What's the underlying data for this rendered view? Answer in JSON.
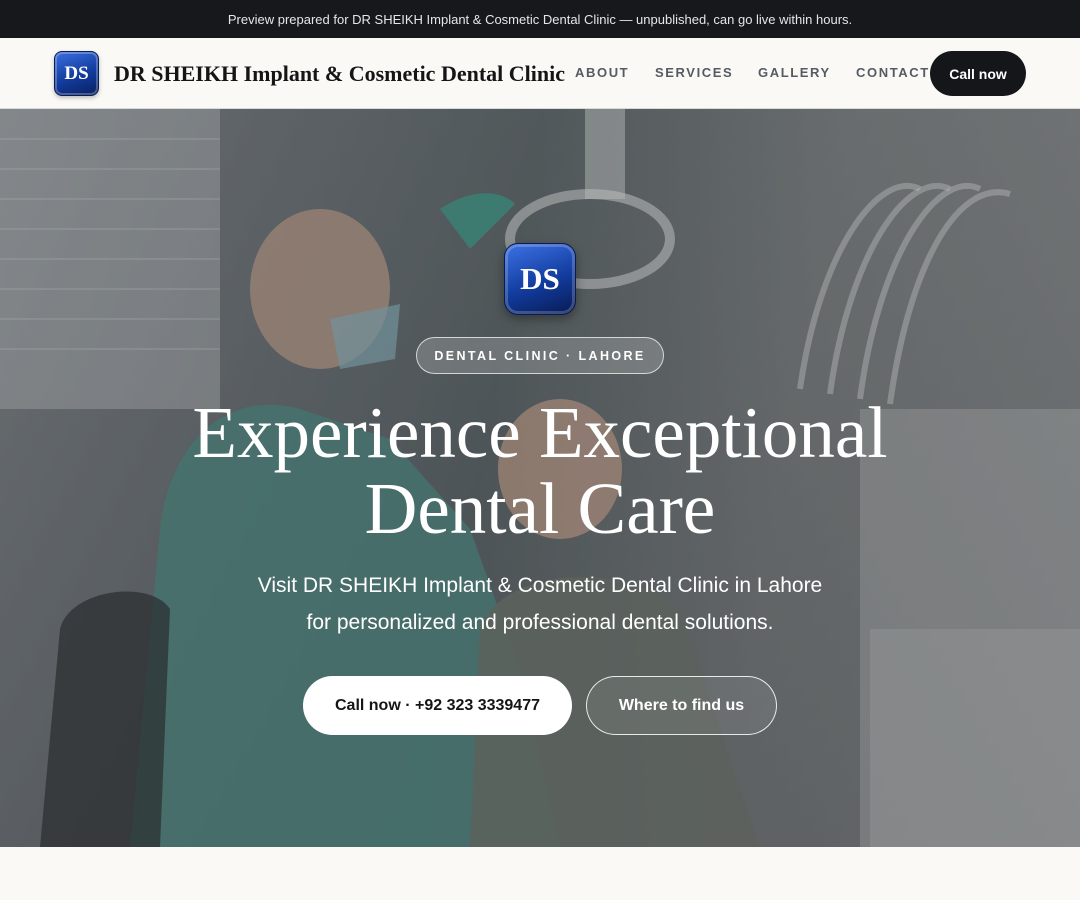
{
  "banner": {
    "text": "Preview prepared for DR SHEIKH Implant & Cosmetic Dental Clinic — unpublished, can go live within hours."
  },
  "header": {
    "logo_text": "DS",
    "brand_name": "DR SHEIKH Implant & Cosmetic Dental Clinic",
    "nav": [
      "ABOUT",
      "SERVICES",
      "GALLERY",
      "CONTACT"
    ],
    "call_button": "Call now"
  },
  "hero": {
    "logo_text": "DS",
    "tag": "DENTAL CLINIC · LAHORE",
    "headline_line1": "Experience Exceptional",
    "headline_line2": "Dental Care",
    "sub_line1": "Visit DR SHEIKH Implant & Cosmetic Dental Clinic in Lahore",
    "sub_line2": "for personalized and professional dental solutions.",
    "cta_primary": "Call now · +92 323 3339477",
    "cta_secondary": "Where to find us"
  },
  "colors": {
    "banner_bg": "#16181c",
    "brand_blue": "#123c9e",
    "dark_button": "#14161a",
    "page_bg": "#faf9f6"
  }
}
